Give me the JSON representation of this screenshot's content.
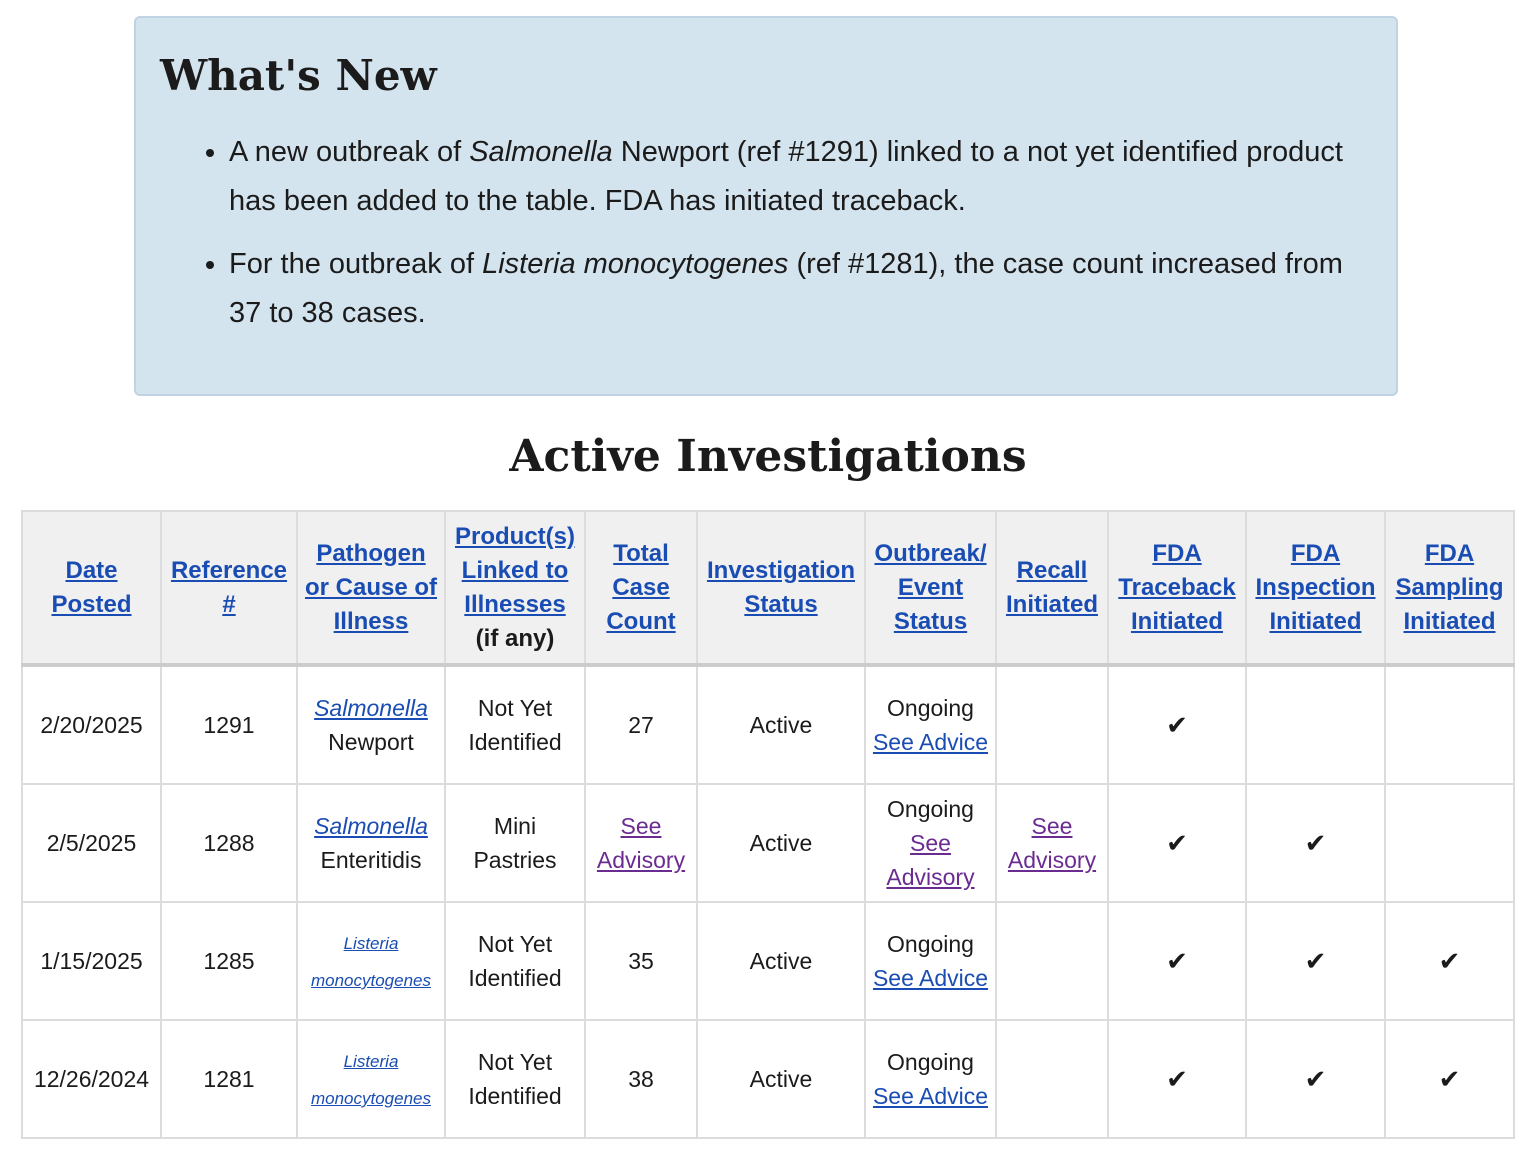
{
  "whats_new": {
    "title": "What's New",
    "items": [
      {
        "before": "A new outbreak of ",
        "italic": "Salmonella",
        "after": " Newport (ref #1291) linked to a not yet identified product has been added to the table. FDA has initiated traceback."
      },
      {
        "before": "For the outbreak of ",
        "italic": "Listeria monocytogenes",
        "after": " (ref #1281), the case count increased from 37 to 38 cases."
      }
    ]
  },
  "section_title": "Active Investigations",
  "table": {
    "headers": [
      {
        "label": "Date Posted"
      },
      {
        "label": "Reference #"
      },
      {
        "label": "Pathogen or Cause of Illness"
      },
      {
        "label": "Product(s) Linked to Illnesses",
        "note": "(if any)"
      },
      {
        "label": "Total Case Count"
      },
      {
        "label": "Investigation Status"
      },
      {
        "label": "Outbreak/ Event Status"
      },
      {
        "label": "Recall Initiated"
      },
      {
        "label": "FDA Traceback Initiated"
      },
      {
        "label": "FDA Inspection Initiated"
      },
      {
        "label": "FDA Sampling Initiated"
      }
    ],
    "rows": [
      {
        "date": "2/20/2025",
        "ref": "1291",
        "pathogen_genus": "Salmonella",
        "pathogen_rest": "Newport",
        "product": "Not Yet Identified",
        "case_count": "27",
        "investigation_status": "Active",
        "outbreak_status": "Ongoing",
        "outbreak_link": "See Advice",
        "recall": "",
        "traceback": "✔",
        "inspection": "",
        "sampling": ""
      },
      {
        "date": "2/5/2025",
        "ref": "1288",
        "pathogen_genus": "Salmonella",
        "pathogen_rest": "Enteritidis",
        "product": "Mini Pastries",
        "case_count": "See Advisory",
        "investigation_status": "Active",
        "outbreak_status": "Ongoing",
        "outbreak_link": "See Advisory",
        "recall": "See Advisory",
        "traceback": "✔",
        "inspection": "✔",
        "sampling": ""
      },
      {
        "date": "1/15/2025",
        "ref": "1285",
        "pathogen_genus": "Listeria monocytogenes",
        "pathogen_rest": "",
        "product": "Not Yet Identified",
        "case_count": "35",
        "investigation_status": "Active",
        "outbreak_status": "Ongoing",
        "outbreak_link": "See Advice",
        "recall": "",
        "traceback": "✔",
        "inspection": "✔",
        "sampling": "✔"
      },
      {
        "date": "12/26/2024",
        "ref": "1281",
        "pathogen_genus": "Listeria monocytogenes",
        "pathogen_rest": "",
        "product": "Not Yet Identified",
        "case_count": "38",
        "investigation_status": "Active",
        "outbreak_status": "Ongoing",
        "outbreak_link": "See Advice",
        "recall": "",
        "traceback": "✔",
        "inspection": "✔",
        "sampling": "✔"
      }
    ]
  }
}
